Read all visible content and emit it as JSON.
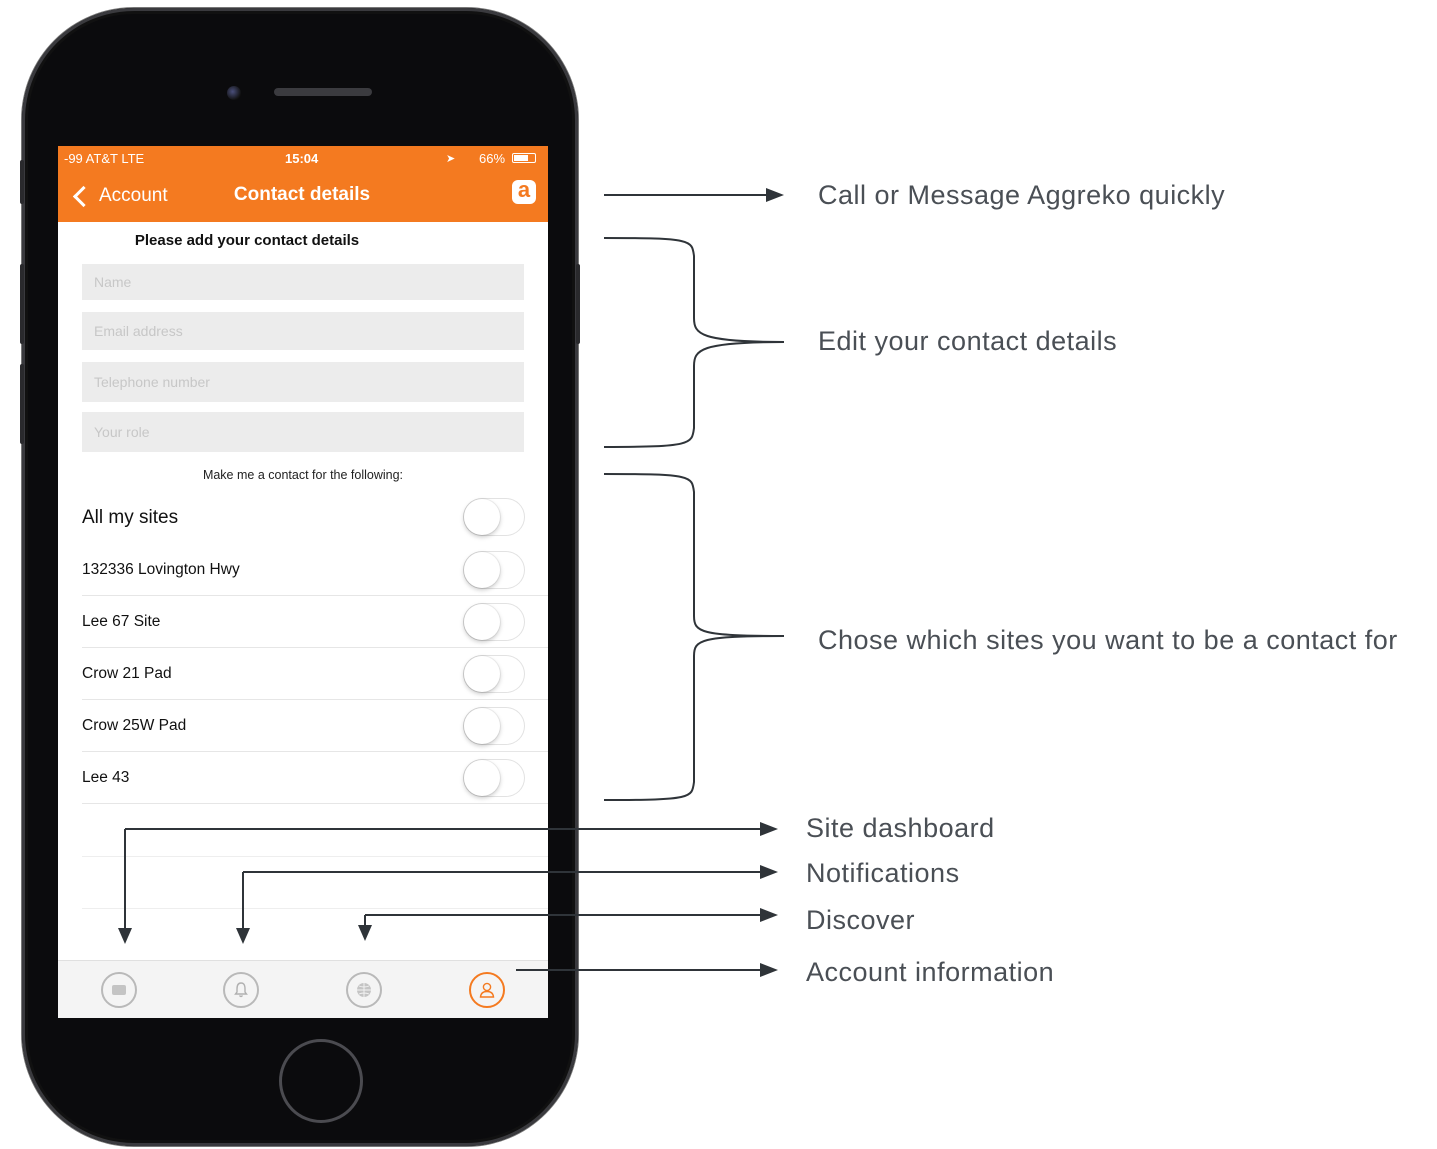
{
  "status_bar": {
    "carrier": "-99 AT&T  LTE",
    "time": "15:04",
    "battery": "66%"
  },
  "nav": {
    "back_label": "Account",
    "title": "Contact details",
    "logo_letter": "a"
  },
  "form": {
    "heading": "Please add your contact details",
    "fields": [
      {
        "placeholder": "Name"
      },
      {
        "placeholder": "Email address"
      },
      {
        "placeholder": "Telephone number"
      },
      {
        "placeholder": "Your role"
      }
    ],
    "subheading": "Make me a contact for the following:"
  },
  "sites": [
    {
      "label": "All my sites",
      "on": false
    },
    {
      "label": "132336 Lovington Hwy",
      "on": false
    },
    {
      "label": "Lee 67 Site",
      "on": false
    },
    {
      "label": "Crow 21 Pad",
      "on": false
    },
    {
      "label": "Crow 25W Pad",
      "on": false
    },
    {
      "label": "Lee 43",
      "on": false
    }
  ],
  "tabs": [
    {
      "name": "site-dashboard-icon",
      "active": false
    },
    {
      "name": "notifications-bell-icon",
      "active": false
    },
    {
      "name": "discover-globe-icon",
      "active": false
    },
    {
      "name": "account-person-icon",
      "active": true
    }
  ],
  "annotations": {
    "call_message": "Call or Message Aggreko quickly",
    "edit_details": "Edit your contact details",
    "choose_sites": "Chose which sites you want to be a contact for",
    "site_dashboard": "Site dashboard",
    "notifications": "Notifications",
    "discover": "Discover",
    "account_info": "Account information"
  },
  "colors": {
    "brand_orange": "#f47a20",
    "annotation_text": "#4a4f55",
    "phone_body": "#0b0b0d"
  }
}
